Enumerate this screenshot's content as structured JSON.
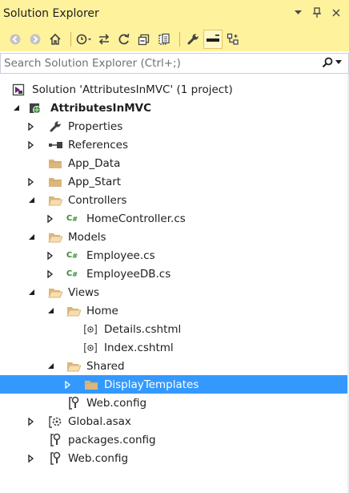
{
  "window": {
    "title": "Solution Explorer"
  },
  "search": {
    "placeholder": "Search Solution Explorer (Ctrl+;)"
  },
  "tree": {
    "solution": "Solution 'AttributesInMVC' (1 project)",
    "project": "AttributesInMVC",
    "properties": "Properties",
    "references": "References",
    "app_data": "App_Data",
    "app_start": "App_Start",
    "controllers": "Controllers",
    "home_controller": "HomeController.cs",
    "models": "Models",
    "employee": "Employee.cs",
    "employee_db": "EmployeeDB.cs",
    "views": "Views",
    "home": "Home",
    "details": "Details.cshtml",
    "index": "Index.cshtml",
    "shared": "Shared",
    "display_templates": "DisplayTemplates",
    "views_web_config": "Web.config",
    "global_asax": "Global.asax",
    "packages_config": "packages.config",
    "web_config": "Web.config"
  },
  "colors": {
    "title_bar": "#fff29d",
    "selection": "#3399ff",
    "folder": "#dcb67a",
    "csharp": "#388a34"
  }
}
